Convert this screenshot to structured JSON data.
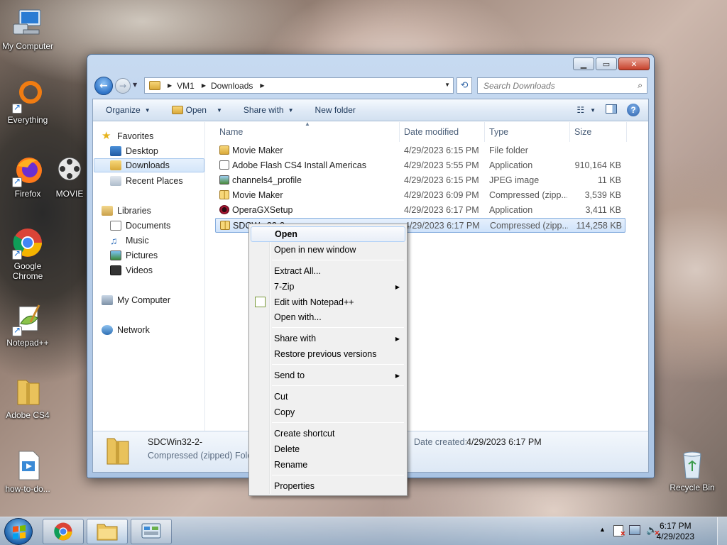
{
  "desktop": {
    "icons": [
      {
        "label": "My Computer"
      },
      {
        "label": "Everything"
      },
      {
        "label": "Firefox"
      },
      {
        "label": "MOVIE"
      },
      {
        "label": "Google Chrome"
      },
      {
        "label": "Notepad++"
      },
      {
        "label": "Adobe CS4"
      },
      {
        "label": "how-to-do..."
      },
      {
        "label": "Recycle Bin"
      }
    ]
  },
  "window": {
    "address": {
      "segments": [
        "VM1",
        "Downloads"
      ]
    },
    "search_placeholder": "Search Downloads",
    "commands": {
      "organize": "Organize",
      "open": "Open",
      "share_with": "Share with",
      "new_folder": "New folder"
    },
    "nav": {
      "favorites": "Favorites",
      "desktop": "Desktop",
      "downloads": "Downloads",
      "recent_places": "Recent Places",
      "libraries": "Libraries",
      "documents": "Documents",
      "music": "Music",
      "pictures": "Pictures",
      "videos": "Videos",
      "my_computer": "My Computer",
      "network": "Network"
    },
    "columns": {
      "name": "Name",
      "date": "Date modified",
      "type": "Type",
      "size": "Size"
    },
    "files": [
      {
        "name": "Movie Maker",
        "date": "4/29/2023 6:15 PM",
        "type": "File folder",
        "size": ""
      },
      {
        "name": "Adobe Flash CS4 Install Americas",
        "date": "4/29/2023 5:55 PM",
        "type": "Application",
        "size": "910,164 KB"
      },
      {
        "name": "channels4_profile",
        "date": "4/29/2023 6:15 PM",
        "type": "JPEG image",
        "size": "11 KB"
      },
      {
        "name": "Movie Maker",
        "date": "4/29/2023 6:09 PM",
        "type": "Compressed (zipp...",
        "size": "3,539 KB"
      },
      {
        "name": "OperaGXSetup",
        "date": "4/29/2023 6:17 PM",
        "type": "Application",
        "size": "3,411 KB"
      },
      {
        "name": "SDCW...32-2-",
        "date": "4/29/2023 6:17 PM",
        "type": "Compressed (zipp...",
        "size": "114,258 KB"
      }
    ],
    "details": {
      "name": "SDCWin32-2-",
      "type": "Compressed (zipped) Folde",
      "date_created_label": "Date created:",
      "date_created": "4/29/2023 6:17 PM"
    }
  },
  "context_menu": {
    "items": [
      "Open",
      "Open in new window",
      "Extract All...",
      "7-Zip",
      "Edit with Notepad++",
      "Open with...",
      "Share with",
      "Restore previous versions",
      "Send to",
      "Cut",
      "Copy",
      "Create shortcut",
      "Delete",
      "Rename",
      "Properties"
    ]
  },
  "taskbar": {
    "clock_time": "6:17 PM",
    "clock_date": "4/29/2023"
  },
  "colors": {
    "selection_blue": "#cfe3fb",
    "window_frame": "#a9c3e3",
    "taskbar": "#9fb8d2"
  }
}
